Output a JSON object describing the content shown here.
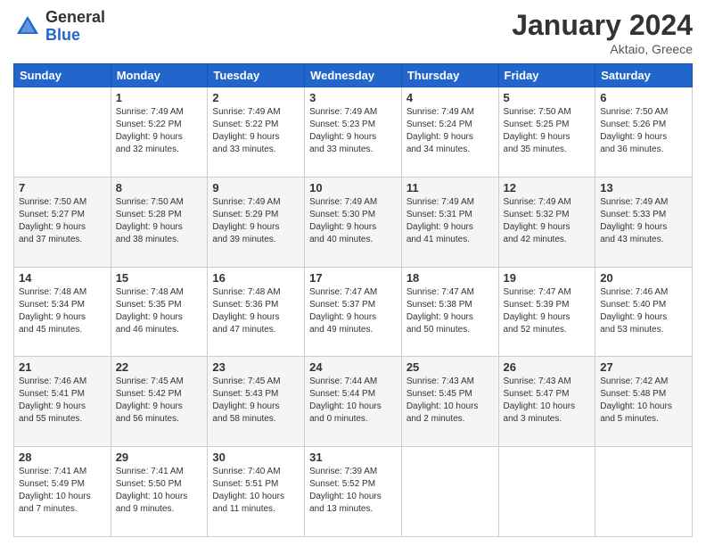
{
  "header": {
    "logo": {
      "general": "General",
      "blue": "Blue"
    },
    "title": "January 2024",
    "subtitle": "Aktaio, Greece"
  },
  "weekdays": [
    "Sunday",
    "Monday",
    "Tuesday",
    "Wednesday",
    "Thursday",
    "Friday",
    "Saturday"
  ],
  "weeks": [
    [
      {
        "day": "",
        "info": ""
      },
      {
        "day": "1",
        "info": "Sunrise: 7:49 AM\nSunset: 5:22 PM\nDaylight: 9 hours\nand 32 minutes."
      },
      {
        "day": "2",
        "info": "Sunrise: 7:49 AM\nSunset: 5:22 PM\nDaylight: 9 hours\nand 33 minutes."
      },
      {
        "day": "3",
        "info": "Sunrise: 7:49 AM\nSunset: 5:23 PM\nDaylight: 9 hours\nand 33 minutes."
      },
      {
        "day": "4",
        "info": "Sunrise: 7:49 AM\nSunset: 5:24 PM\nDaylight: 9 hours\nand 34 minutes."
      },
      {
        "day": "5",
        "info": "Sunrise: 7:50 AM\nSunset: 5:25 PM\nDaylight: 9 hours\nand 35 minutes."
      },
      {
        "day": "6",
        "info": "Sunrise: 7:50 AM\nSunset: 5:26 PM\nDaylight: 9 hours\nand 36 minutes."
      }
    ],
    [
      {
        "day": "7",
        "info": "Sunrise: 7:50 AM\nSunset: 5:27 PM\nDaylight: 9 hours\nand 37 minutes."
      },
      {
        "day": "8",
        "info": "Sunrise: 7:50 AM\nSunset: 5:28 PM\nDaylight: 9 hours\nand 38 minutes."
      },
      {
        "day": "9",
        "info": "Sunrise: 7:49 AM\nSunset: 5:29 PM\nDaylight: 9 hours\nand 39 minutes."
      },
      {
        "day": "10",
        "info": "Sunrise: 7:49 AM\nSunset: 5:30 PM\nDaylight: 9 hours\nand 40 minutes."
      },
      {
        "day": "11",
        "info": "Sunrise: 7:49 AM\nSunset: 5:31 PM\nDaylight: 9 hours\nand 41 minutes."
      },
      {
        "day": "12",
        "info": "Sunrise: 7:49 AM\nSunset: 5:32 PM\nDaylight: 9 hours\nand 42 minutes."
      },
      {
        "day": "13",
        "info": "Sunrise: 7:49 AM\nSunset: 5:33 PM\nDaylight: 9 hours\nand 43 minutes."
      }
    ],
    [
      {
        "day": "14",
        "info": "Sunrise: 7:48 AM\nSunset: 5:34 PM\nDaylight: 9 hours\nand 45 minutes."
      },
      {
        "day": "15",
        "info": "Sunrise: 7:48 AM\nSunset: 5:35 PM\nDaylight: 9 hours\nand 46 minutes."
      },
      {
        "day": "16",
        "info": "Sunrise: 7:48 AM\nSunset: 5:36 PM\nDaylight: 9 hours\nand 47 minutes."
      },
      {
        "day": "17",
        "info": "Sunrise: 7:47 AM\nSunset: 5:37 PM\nDaylight: 9 hours\nand 49 minutes."
      },
      {
        "day": "18",
        "info": "Sunrise: 7:47 AM\nSunset: 5:38 PM\nDaylight: 9 hours\nand 50 minutes."
      },
      {
        "day": "19",
        "info": "Sunrise: 7:47 AM\nSunset: 5:39 PM\nDaylight: 9 hours\nand 52 minutes."
      },
      {
        "day": "20",
        "info": "Sunrise: 7:46 AM\nSunset: 5:40 PM\nDaylight: 9 hours\nand 53 minutes."
      }
    ],
    [
      {
        "day": "21",
        "info": "Sunrise: 7:46 AM\nSunset: 5:41 PM\nDaylight: 9 hours\nand 55 minutes."
      },
      {
        "day": "22",
        "info": "Sunrise: 7:45 AM\nSunset: 5:42 PM\nDaylight: 9 hours\nand 56 minutes."
      },
      {
        "day": "23",
        "info": "Sunrise: 7:45 AM\nSunset: 5:43 PM\nDaylight: 9 hours\nand 58 minutes."
      },
      {
        "day": "24",
        "info": "Sunrise: 7:44 AM\nSunset: 5:44 PM\nDaylight: 10 hours\nand 0 minutes."
      },
      {
        "day": "25",
        "info": "Sunrise: 7:43 AM\nSunset: 5:45 PM\nDaylight: 10 hours\nand 2 minutes."
      },
      {
        "day": "26",
        "info": "Sunrise: 7:43 AM\nSunset: 5:47 PM\nDaylight: 10 hours\nand 3 minutes."
      },
      {
        "day": "27",
        "info": "Sunrise: 7:42 AM\nSunset: 5:48 PM\nDaylight: 10 hours\nand 5 minutes."
      }
    ],
    [
      {
        "day": "28",
        "info": "Sunrise: 7:41 AM\nSunset: 5:49 PM\nDaylight: 10 hours\nand 7 minutes."
      },
      {
        "day": "29",
        "info": "Sunrise: 7:41 AM\nSunset: 5:50 PM\nDaylight: 10 hours\nand 9 minutes."
      },
      {
        "day": "30",
        "info": "Sunrise: 7:40 AM\nSunset: 5:51 PM\nDaylight: 10 hours\nand 11 minutes."
      },
      {
        "day": "31",
        "info": "Sunrise: 7:39 AM\nSunset: 5:52 PM\nDaylight: 10 hours\nand 13 minutes."
      },
      {
        "day": "",
        "info": ""
      },
      {
        "day": "",
        "info": ""
      },
      {
        "day": "",
        "info": ""
      }
    ]
  ]
}
